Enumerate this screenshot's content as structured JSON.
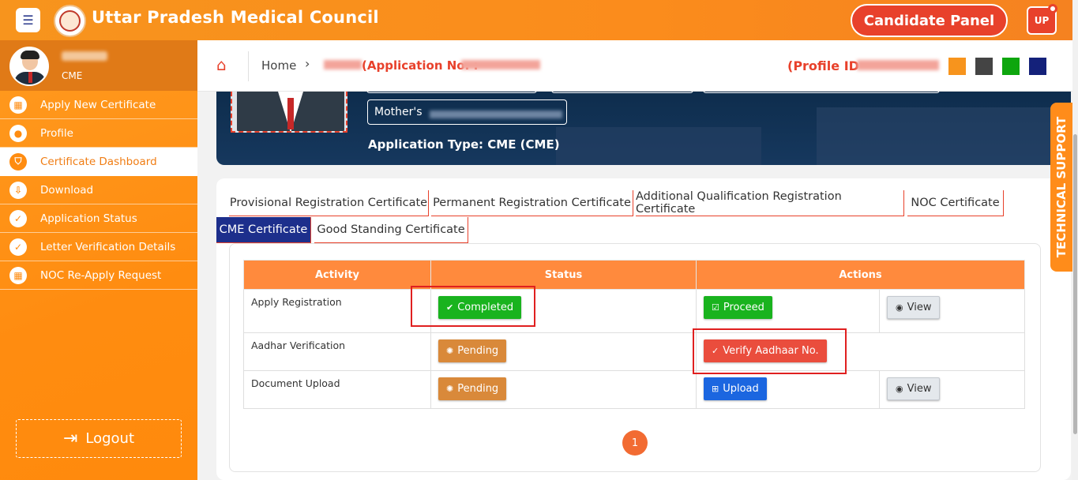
{
  "header": {
    "menu_icon": "hamburger-icon",
    "title": "Uttar Pradesh Medical Council",
    "candidate_panel": "Candidate Panel",
    "state_badge": "UP"
  },
  "sidebar": {
    "user_role": "CME",
    "items": [
      {
        "label": "Apply New Certificate",
        "icon": "grid-icon"
      },
      {
        "label": "Profile",
        "icon": "user-icon"
      },
      {
        "label": "Certificate Dashboard",
        "icon": "shield-icon"
      },
      {
        "label": "Download",
        "icon": "download-icon"
      },
      {
        "label": "Application Status",
        "icon": "check-icon"
      },
      {
        "label": "Letter Verification Details",
        "icon": "check-icon"
      },
      {
        "label": "NOC Re-Apply Request",
        "icon": "grid-icon"
      }
    ],
    "logout": "Logout"
  },
  "breadcrumb": {
    "home": "Home",
    "application_no": "(Application No. :",
    "profile_id": "(Profile ID"
  },
  "theme_colors": [
    "#f7941d",
    "#444444",
    "#0ea60e",
    "#14217a"
  ],
  "profile": {
    "mother_label": "Mother's",
    "application_type": "Application Type: CME (CME)"
  },
  "tabs": [
    "Provisional Registration Certificate",
    "Permanent Registration Certificate",
    "Additional Qualification Registration Certificate",
    "NOC Certificate",
    "CME Certificate",
    "Good Standing Certificate"
  ],
  "active_tab": "CME Certificate",
  "table": {
    "headers": [
      "Activity",
      "Status",
      "Actions"
    ],
    "rows": [
      {
        "activity": "Apply Registration",
        "status": "Completed",
        "action": "Proceed",
        "secondary": "View"
      },
      {
        "activity": "Aadhar Verification",
        "status": "Pending",
        "action": "Verify Aadhaar No.",
        "secondary": ""
      },
      {
        "activity": "Document Upload",
        "status": "Pending",
        "action": "Upload",
        "secondary": "View"
      }
    ]
  },
  "pagination": {
    "current": "1"
  },
  "technical_support": "TECHNICAL SUPPORT"
}
